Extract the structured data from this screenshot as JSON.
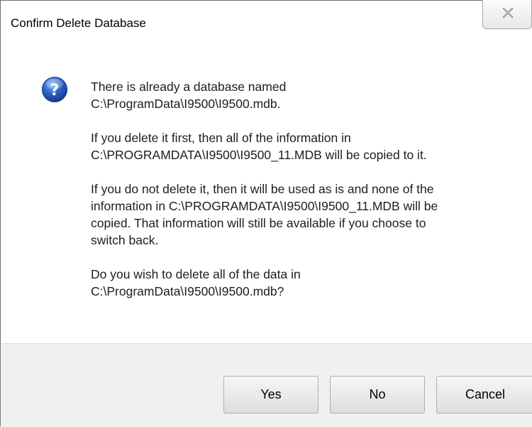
{
  "dialog": {
    "title": "Confirm Delete Database",
    "close_icon": "close-icon",
    "icon": "question-icon",
    "message": [
      "There is already a database named\nC:\\ProgramData\\I9500\\I9500.mdb.",
      "If you delete it first, then all of the information in\nC:\\PROGRAMDATA\\I9500\\I9500_11.MDB will be copied to it.",
      "If you do not delete it, then it will be used as is and none of the\ninformation in C:\\PROGRAMDATA\\I9500\\I9500_11.MDB will be\ncopied.  That information will still be available if you choose to\nswitch back.",
      "Do you wish to delete all of the data in\nC:\\ProgramData\\I9500\\I9500.mdb?"
    ],
    "buttons": {
      "yes": "Yes",
      "no": "No",
      "cancel": "Cancel"
    }
  },
  "colors": {
    "icon_blue": "#2a5fc4",
    "button_area": "#f0f0f0"
  }
}
